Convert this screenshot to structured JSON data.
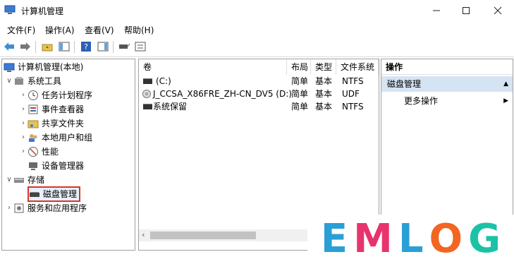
{
  "window": {
    "title": "计算机管理"
  },
  "menu": [
    "文件(F)",
    "操作(A)",
    "查看(V)",
    "帮助(H)"
  ],
  "tree": {
    "root": "计算机管理(本地)",
    "system_tools": "系统工具",
    "system_items": [
      "任务计划程序",
      "事件查看器",
      "共享文件夹",
      "本地用户和组",
      "性能",
      "设备管理器"
    ],
    "storage": "存储",
    "disk_mgmt": "磁盘管理",
    "services": "服务和应用程序"
  },
  "list": {
    "columns": [
      "卷",
      "布局",
      "类型",
      "文件系统"
    ],
    "rows": [
      {
        "volume": "(C:)",
        "layout": "简单",
        "type": "基本",
        "fs": "NTFS"
      },
      {
        "volume": "J_CCSA_X86FRE_ZH-CN_DV5 (D:)",
        "layout": "简单",
        "type": "基本",
        "fs": "UDF"
      },
      {
        "volume": "系统保留",
        "layout": "简单",
        "type": "基本",
        "fs": "NTFS"
      }
    ]
  },
  "actions": {
    "header": "操作",
    "selected": "磁盘管理",
    "more": "更多操作"
  },
  "watermark": {
    "letters": [
      "E",
      "M",
      "L",
      "O",
      "G"
    ],
    "colors": [
      "#2a9fd6",
      "#e8336d",
      "#2a9fd6",
      "#f26522",
      "#19c3a6"
    ]
  },
  "colors": {
    "selection": "#d5e4f3",
    "highlight_box": "#d9342b"
  }
}
